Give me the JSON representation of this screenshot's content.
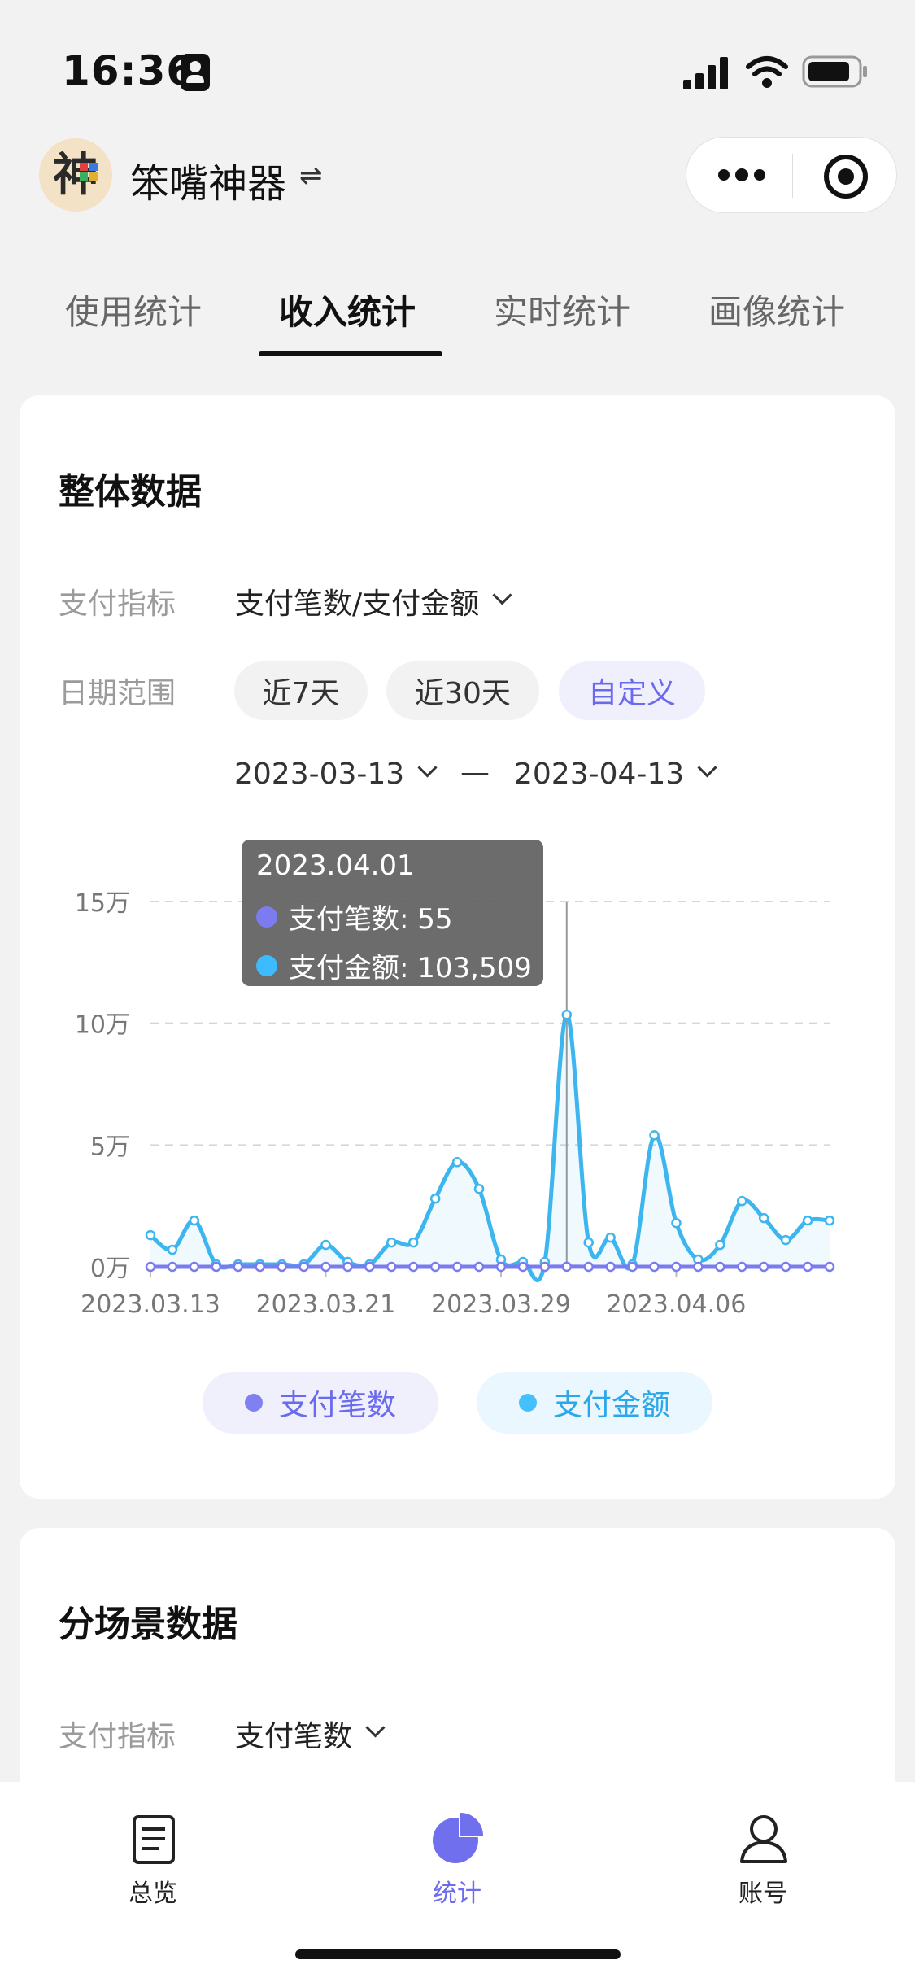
{
  "status_bar": {
    "time": "16:36"
  },
  "header": {
    "app_name": "笨嘴神器",
    "avatar_char": "神"
  },
  "tabs": [
    {
      "label": "使用统计",
      "active": false
    },
    {
      "label": "收入统计",
      "active": true
    },
    {
      "label": "实时统计",
      "active": false
    },
    {
      "label": "画像统计",
      "active": false
    }
  ],
  "overall": {
    "title": "整体数据",
    "metric_label": "支付指标",
    "metric_value": "支付笔数/支付金额",
    "date_label": "日期范围",
    "range_buttons": [
      {
        "label": "近7天",
        "selected": false
      },
      {
        "label": "近30天",
        "selected": false
      },
      {
        "label": "自定义",
        "selected": true
      }
    ],
    "start_date": "2023-03-13",
    "date_separator": "—",
    "end_date": "2023-04-13",
    "tooltip": {
      "date": "2023.04.01",
      "rows": [
        {
          "label": "支付笔数: 55",
          "color": "#7c7cf0"
        },
        {
          "label": "支付金额: 103,509",
          "color": "#3dbbff"
        }
      ]
    },
    "legend": [
      {
        "name": "支付笔数",
        "color": "#8080f0",
        "bg": "#f0f0fd"
      },
      {
        "name": "支付金额",
        "color": "#45c0ff",
        "bg": "#eaf7ff"
      }
    ]
  },
  "chart_data": {
    "type": "line",
    "x_ticks": [
      "2023.03.13",
      "2023.03.21",
      "2023.03.29",
      "2023.04.06"
    ],
    "y_ticks": [
      "0万",
      "5万",
      "10万",
      "15万"
    ],
    "ylim": [
      0,
      150000
    ],
    "x": [
      "03.13",
      "03.14",
      "03.15",
      "03.16",
      "03.17",
      "03.18",
      "03.19",
      "03.20",
      "03.21",
      "03.22",
      "03.23",
      "03.24",
      "03.25",
      "03.26",
      "03.27",
      "03.28",
      "03.29",
      "03.30",
      "03.31",
      "04.01",
      "04.02",
      "04.03",
      "04.04",
      "04.05",
      "04.06",
      "04.07",
      "04.08",
      "04.09",
      "04.10",
      "04.11",
      "04.12",
      "04.13"
    ],
    "grid": true,
    "series": [
      {
        "name": "支付笔数",
        "color": "#7b7bf0",
        "values": [
          3,
          1,
          2,
          0,
          0,
          0,
          0,
          0,
          2,
          1,
          0,
          1,
          1,
          3,
          4,
          3,
          1,
          0,
          0,
          55,
          2,
          2,
          0,
          3,
          1,
          0,
          1,
          2,
          1,
          1,
          1,
          1
        ]
      },
      {
        "name": "支付金额",
        "color": "#3db5ee",
        "values": [
          13000,
          7000,
          19000,
          1000,
          1000,
          1000,
          1000,
          1000,
          9000,
          2000,
          1000,
          10000,
          10000,
          28000,
          43000,
          32000,
          3000,
          2000,
          2000,
          103509,
          10000,
          12000,
          1000,
          54000,
          18000,
          3000,
          9000,
          27000,
          20000,
          11000,
          19000,
          19000
        ]
      }
    ]
  },
  "scene": {
    "title": "分场景数据",
    "metric_label": "支付指标",
    "metric_value": "支付笔数"
  },
  "bottom_nav": [
    {
      "label": "总览",
      "icon": "document-icon",
      "active": false
    },
    {
      "label": "统计",
      "icon": "pie-chart-icon",
      "active": true
    },
    {
      "label": "账号",
      "icon": "user-icon",
      "active": false
    }
  ]
}
